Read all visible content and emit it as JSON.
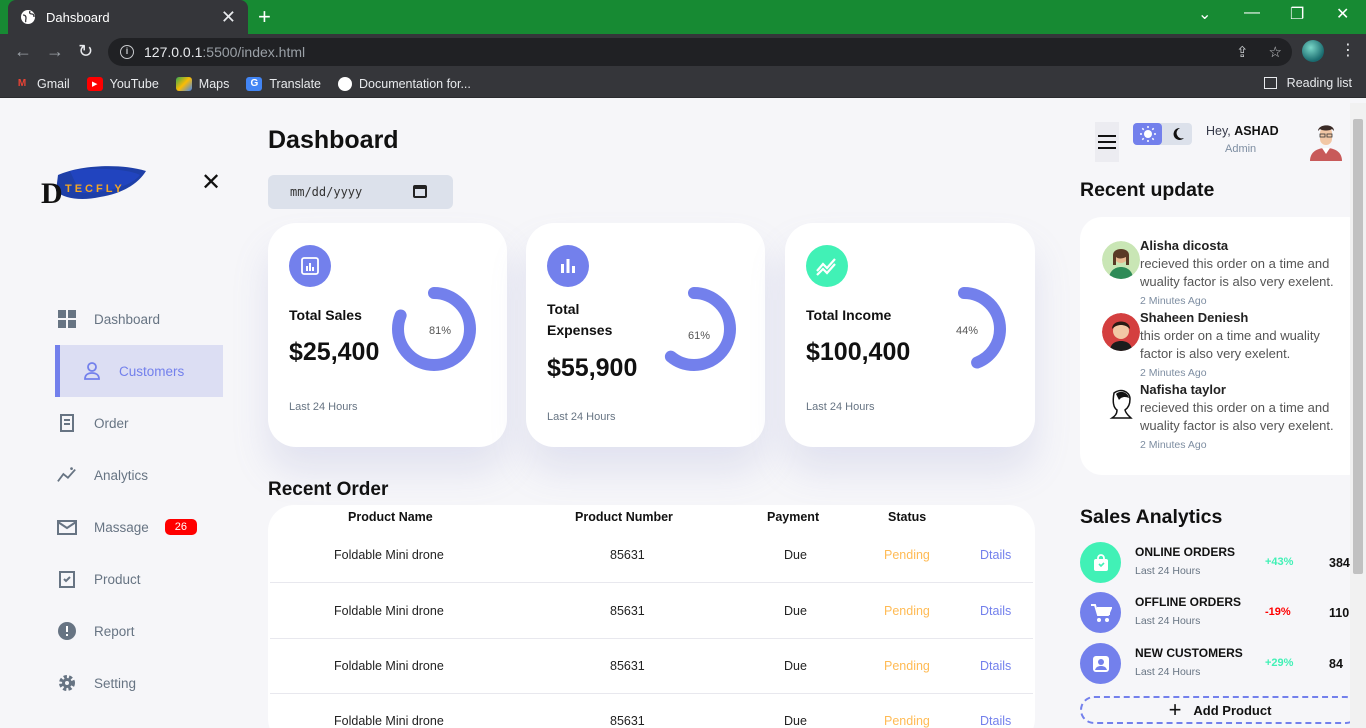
{
  "browser": {
    "tab_title": "Dahsboard",
    "url_host": "127.0.0.1",
    "url_path": ":5500/index.html",
    "bookmarks": [
      "Gmail",
      "YouTube",
      "Maps",
      "Translate",
      "Documentation for..."
    ],
    "reading_list": "Reading list"
  },
  "sidebar": {
    "items": [
      {
        "label": "Dashboard",
        "icon": "grid-icon"
      },
      {
        "label": "Customers",
        "icon": "person-icon",
        "active": true
      },
      {
        "label": "Order",
        "icon": "receipt-icon"
      },
      {
        "label": "Analytics",
        "icon": "insights-icon"
      },
      {
        "label": "Massage",
        "icon": "mail-icon",
        "badge": "26"
      },
      {
        "label": "Product",
        "icon": "inventory-icon"
      },
      {
        "label": "Report",
        "icon": "report-icon"
      },
      {
        "label": "Setting",
        "icon": "gear-icon"
      }
    ]
  },
  "main": {
    "title": "Dashboard",
    "date_placeholder": "mm/dd/yyyy",
    "cards": [
      {
        "label": "Total Sales",
        "value": "$25,400",
        "percent": "81%",
        "percent_value": 81,
        "footer": "Last 24 Hours",
        "color": "#7380ec"
      },
      {
        "label": "Total Expenses",
        "value": "$55,900",
        "percent": "61%",
        "percent_value": 61,
        "footer": "Last 24 Hours",
        "color": "#7380ec"
      },
      {
        "label": "Total Income",
        "value": "$100,400",
        "percent": "44%",
        "percent_value": 44,
        "footer": "Last 24 Hours",
        "color": "#41f1b6"
      }
    ],
    "recent_order_title": "Recent Order",
    "table": {
      "headers": [
        "Product Name",
        "Product Number",
        "Payment",
        "Status"
      ],
      "rows": [
        {
          "name": "Foldable Mini drone",
          "number": "85631",
          "payment": "Due",
          "status": "Pending",
          "link": "Dtails"
        },
        {
          "name": "Foldable Mini drone",
          "number": "85631",
          "payment": "Due",
          "status": "Pending",
          "link": "Dtails"
        },
        {
          "name": "Foldable Mini drone",
          "number": "85631",
          "payment": "Due",
          "status": "Pending",
          "link": "Dtails"
        },
        {
          "name": "Foldable Mini drone",
          "number": "85631",
          "payment": "Due",
          "status": "Pending",
          "link": "Dtails"
        }
      ]
    }
  },
  "profile": {
    "greeting": "Hey, ",
    "name": "ASHAD",
    "role": "Admin"
  },
  "recent_update": {
    "title": "Recent update",
    "items": [
      {
        "name": "Alisha dicosta",
        "text": "recieved this order on a time and wuality factor is also very exelent.",
        "time": "2 Minutes Ago"
      },
      {
        "name": "Shaheen Deniesh",
        "text": "this order on a time and wuality factor is also very exelent.",
        "time": "2 Minutes Ago"
      },
      {
        "name": "Nafisha taylor",
        "text": "recieved this order on a time and wuality factor is also very exelent.",
        "time": "2 Minutes Ago"
      }
    ]
  },
  "sales_analytics": {
    "title": "Sales Analytics",
    "items": [
      {
        "name": "ONLINE ORDERS",
        "sub": "Last 24 Hours",
        "percent": "+43%",
        "number": "384",
        "color": "#41f1b6",
        "pct_color": "#41f1b6"
      },
      {
        "name": "OFFLINE ORDERS",
        "sub": "Last 24 Hours",
        "percent": "-19%",
        "number": "110",
        "color": "#7380ec",
        "pct_color": "#ff0000"
      },
      {
        "name": "NEW CUSTOMERS",
        "sub": "Last 24 Hours",
        "percent": "+29%",
        "number": "84",
        "color": "#7380ec",
        "pct_color": "#41f1b6"
      }
    ],
    "add_product": "Add Product"
  }
}
